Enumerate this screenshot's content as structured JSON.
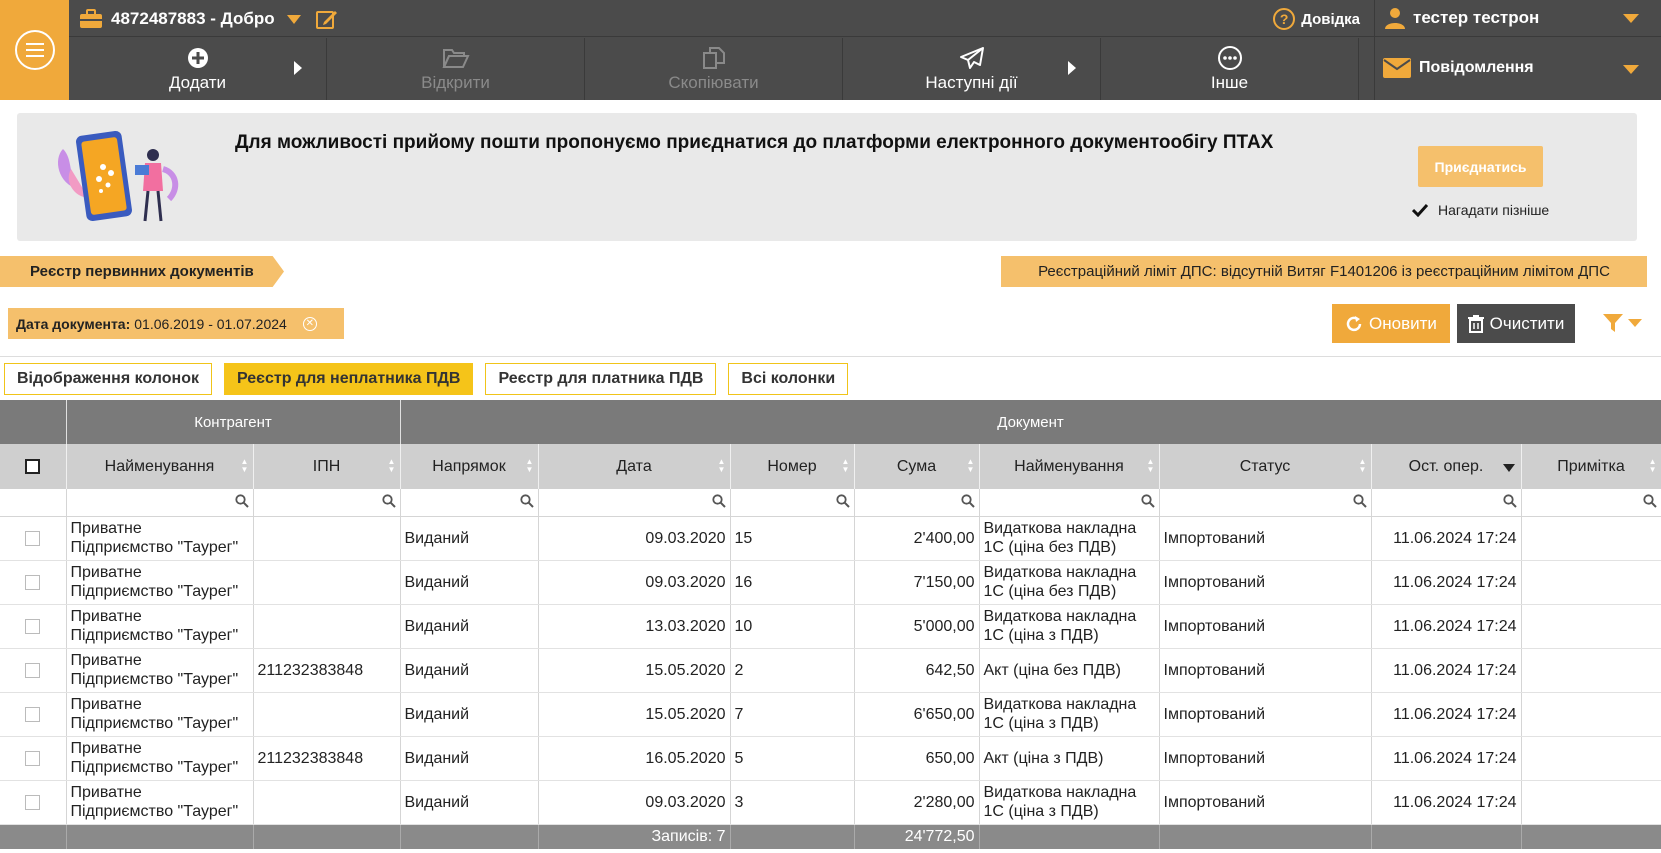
{
  "header": {
    "company": "4872487883 - Добро",
    "help": "Довідка",
    "user": "тестер тестрон",
    "messages": "Повідомлення"
  },
  "toolbar": {
    "add": "Додати",
    "open": "Відкрити",
    "copy": "Скопіювати",
    "next": "Наступні дії",
    "other": "Інше"
  },
  "banner": {
    "text": "Для можливості прийому пошти пропонуємо приєднатися до платформи електронного документообігу ПТАХ",
    "join": "Приєднатись",
    "remind": "Нагадати пізніше"
  },
  "breadcrumb": "Реєстр первинних документів",
  "limit_notice": "Реєстраційний ліміт ДПС: відсутній Витяг F1401206 із реєстраційним лімітом ДПС",
  "filter": {
    "date_label": "Дата документа:",
    "date_value": "01.06.2019 - 01.07.2024"
  },
  "actions": {
    "refresh": "Оновити",
    "clear": "Очистити"
  },
  "column_buttons": [
    "Відображення колонок",
    "Реєстр для неплатника ПДВ",
    "Реєстр для платника ПДВ",
    "Всі колонки"
  ],
  "table": {
    "groups": {
      "counterparty": "Контрагент",
      "document": "Документ"
    },
    "columns": [
      "Найменування",
      "ІПН",
      "Напрямок",
      "Дата",
      "Номер",
      "Сума",
      "Найменування",
      "Статус",
      "Ост. опер.",
      "Примітка"
    ],
    "rows": [
      {
        "name": "Приватне Підприємство \"Таурег\"",
        "ipn": "",
        "dir": "Виданий",
        "date": "09.03.2020",
        "num": "15",
        "sum": "2'400,00",
        "doc": "Видаткова накладна 1С (ціна без ПДВ)",
        "status": "Імпортований",
        "last": "11.06.2024 17:24",
        "note": ""
      },
      {
        "name": "Приватне Підприємство \"Таурег\"",
        "ipn": "",
        "dir": "Виданий",
        "date": "09.03.2020",
        "num": "16",
        "sum": "7'150,00",
        "doc": "Видаткова накладна 1С (ціна без ПДВ)",
        "status": "Імпортований",
        "last": "11.06.2024 17:24",
        "note": ""
      },
      {
        "name": "Приватне Підприємство \"Таурег\"",
        "ipn": "",
        "dir": "Виданий",
        "date": "13.03.2020",
        "num": "10",
        "sum": "5'000,00",
        "doc": "Видаткова накладна 1С (ціна з ПДВ)",
        "status": "Імпортований",
        "last": "11.06.2024 17:24",
        "note": ""
      },
      {
        "name": "Приватне Підприємство \"Таурег\"",
        "ipn": "211232383848",
        "dir": "Виданий",
        "date": "15.05.2020",
        "num": "2",
        "sum": "642,50",
        "doc": "Акт (ціна без ПДВ)",
        "status": "Імпортований",
        "last": "11.06.2024 17:24",
        "note": ""
      },
      {
        "name": "Приватне Підприємство \"Таурег\"",
        "ipn": "",
        "dir": "Виданий",
        "date": "15.05.2020",
        "num": "7",
        "sum": "6'650,00",
        "doc": "Видаткова накладна 1С (ціна з ПДВ)",
        "status": "Імпортований",
        "last": "11.06.2024 17:24",
        "note": ""
      },
      {
        "name": "Приватне Підприємство \"Таурег\"",
        "ipn": "211232383848",
        "dir": "Виданий",
        "date": "16.05.2020",
        "num": "5",
        "sum": "650,00",
        "doc": "Акт (ціна з ПДВ)",
        "status": "Імпортований",
        "last": "11.06.2024 17:24",
        "note": ""
      },
      {
        "name": "Приватне Підприємство \"Таурег\"",
        "ipn": "",
        "dir": "Виданий",
        "date": "09.03.2020",
        "num": "3",
        "sum": "2'280,00",
        "doc": "Видаткова накладна 1С (ціна з ПДВ)",
        "status": "Імпортований",
        "last": "11.06.2024 17:24",
        "note": ""
      }
    ],
    "footer": {
      "records": "Записів: 7",
      "total": "24'772,50"
    }
  },
  "colors": {
    "accent": "#f0a93b",
    "dark": "#4b4b4b",
    "light_accent": "#f5c06c"
  }
}
